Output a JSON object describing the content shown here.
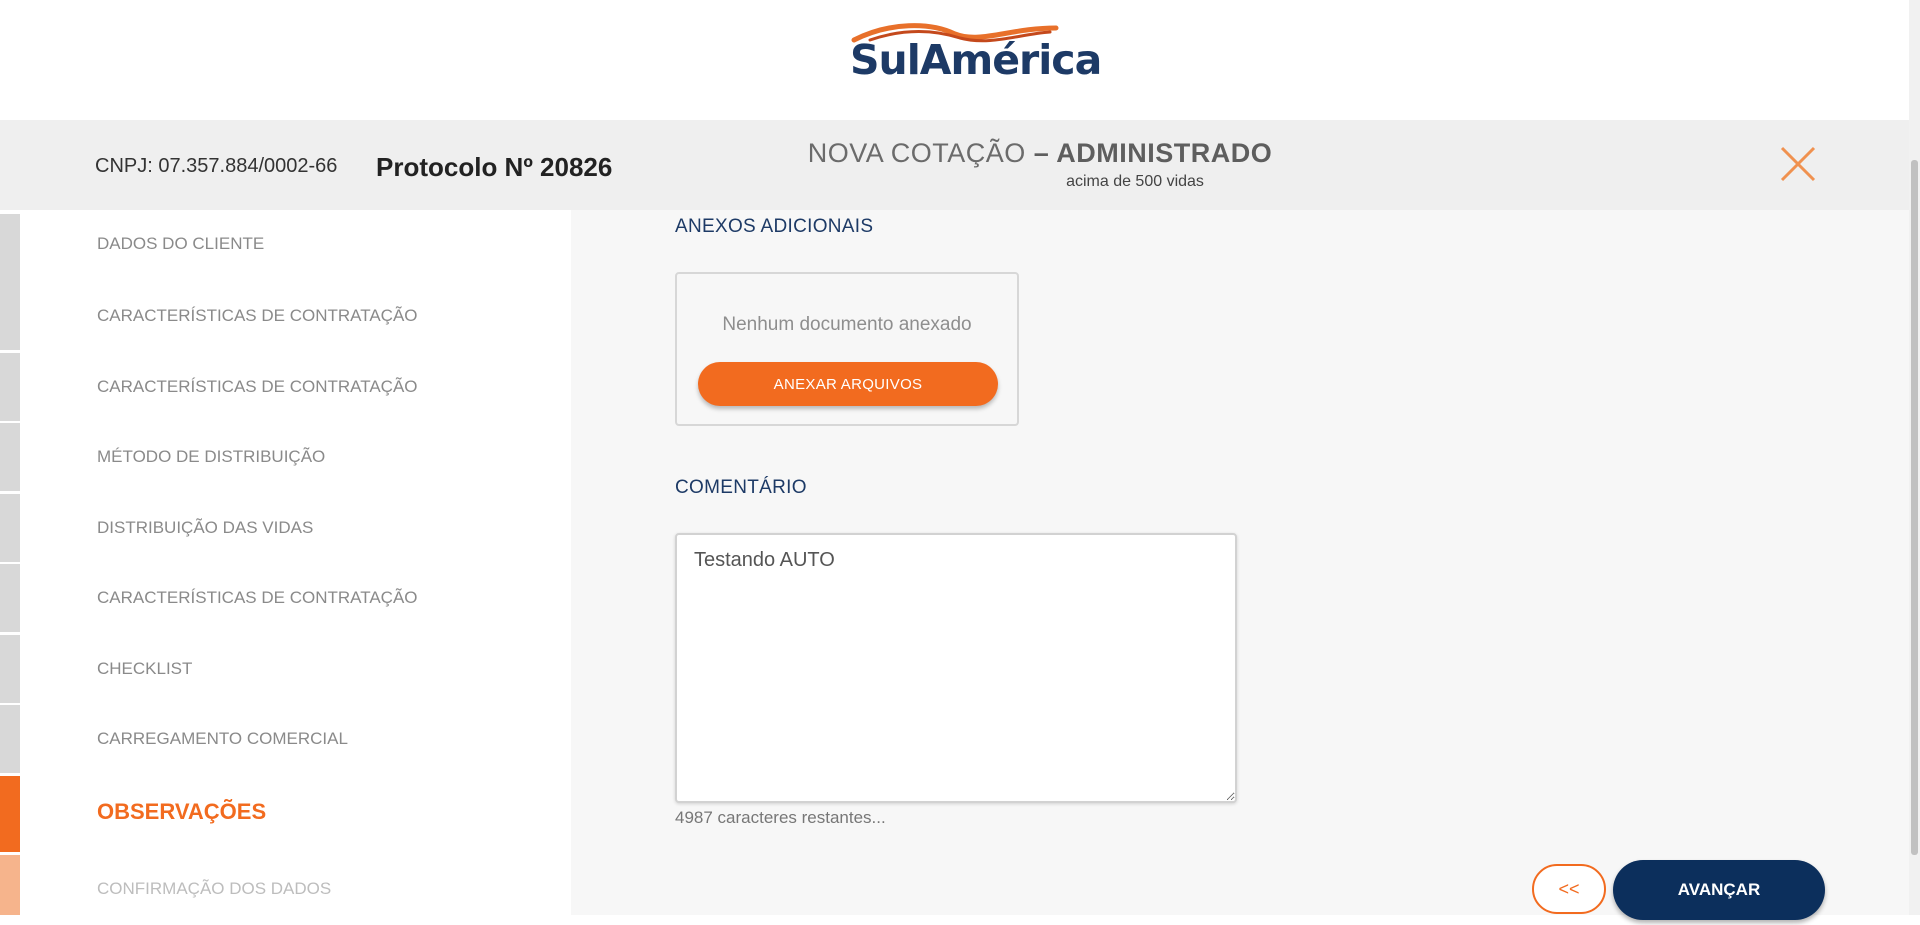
{
  "brand": {
    "logo_text": "SulAmérica",
    "accent_color": "#f26b1f",
    "navy_color": "#1d3a66"
  },
  "header": {
    "cnpj": "CNPJ: 07.357.884/0002-66",
    "protocolo": "Protocolo Nº 20826",
    "title_light": "NOVA COTAÇÃO",
    "title_dash": " – ",
    "title_strong": "ADMINISTRADO",
    "subtitle": "acima de 500 vidas",
    "close_icon": "close-icon"
  },
  "sidebar": {
    "items": [
      {
        "label": "DADOS DO CLIENTE",
        "state": "done"
      },
      {
        "label": "CARACTERÍSTICAS DE CONTRATAÇÃO",
        "state": "done"
      },
      {
        "label": "CARACTERÍSTICAS DE CONTRATAÇÃO",
        "state": "done"
      },
      {
        "label": "MÉTODO DE DISTRIBUIÇÃO",
        "state": "done"
      },
      {
        "label": "DISTRIBUIÇÃO DAS VIDAS",
        "state": "done"
      },
      {
        "label": "CARACTERÍSTICAS DE CONTRATAÇÃO",
        "state": "done"
      },
      {
        "label": "CHECKLIST",
        "state": "done"
      },
      {
        "label": "CARREGAMENTO COMERCIAL",
        "state": "done"
      },
      {
        "label": "OBSERVAÇÕES",
        "state": "active"
      },
      {
        "label": "CONFIRMAÇÃO DOS DADOS",
        "state": "next"
      }
    ]
  },
  "main": {
    "attachments_title": "ANEXOS ADICIONAIS",
    "attachments_empty": "Nenhum documento anexado",
    "attach_button": "ANEXAR ARQUIVOS",
    "comment_title": "COMENTÁRIO",
    "comment_value": "Testando AUTO",
    "counter": "4987 caracteres restantes...",
    "back_button": "<<",
    "next_button": "AVANÇAR"
  }
}
